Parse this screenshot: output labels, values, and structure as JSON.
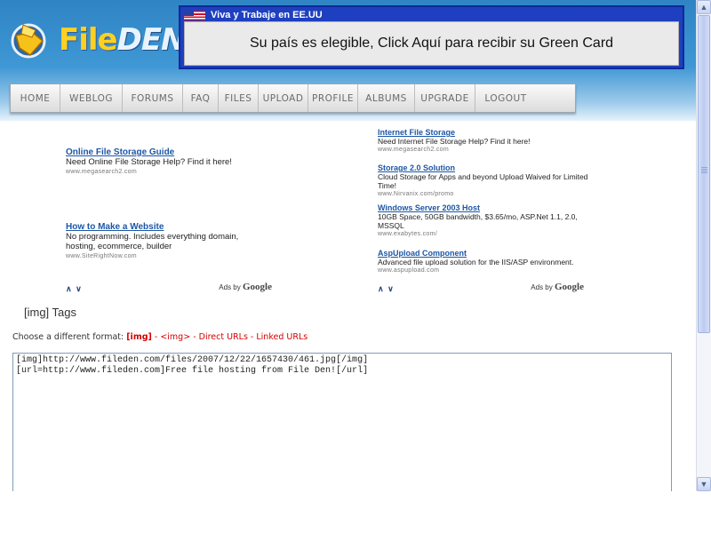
{
  "brand": {
    "file": "File",
    "den": "DEN"
  },
  "banner": {
    "heading": "Viva y Trabaje en EE.UU",
    "text": "Su país es elegible, Click Aquí para recibir su Green Card",
    "flag_icon": "us-flag-icon"
  },
  "nav": [
    "HOME",
    "WEBLOG",
    "FORUMS",
    "FAQ",
    "FILES",
    "UPLOAD",
    "PROFILE",
    "ALBUMS",
    "UPGRADE",
    "LOGOUT"
  ],
  "ads_left": [
    {
      "title": "Online File Storage Guide",
      "desc": "Need Online File Storage Help? Find it here!",
      "url": "www.megasearch2.com"
    },
    {
      "title": "How to Make a Website",
      "desc": "No programming. Includes everything domain, hosting, ecommerce, builder",
      "url": "www.SiteRightNow.com"
    }
  ],
  "ads_right": [
    {
      "title": "Internet File Storage",
      "desc": "Need Internet File Storage Help? Find it here!",
      "url": "www.megasearch2.com"
    },
    {
      "title": "Storage 2.0 Solution",
      "desc": "Cloud Storage for Apps and beyond Upload Waived for Limited Time!",
      "url": "www.Nirvanix.com/promo"
    },
    {
      "title": "Windows Server 2003 Host",
      "desc": "10GB Space, 50GB bandwidth, $3.65/mo, ASP.Net 1.1, 2.0, MSSQL",
      "url": "www.exabytes.com/"
    },
    {
      "title": "AspUpload Component",
      "desc": "Advanced file upload solution for the IIS/ASP environment.",
      "url": "www.aspupload.com"
    }
  ],
  "ads_footer": {
    "arrows": "∧ ∨",
    "adsby": "Ads by",
    "google": "Google"
  },
  "section_title": "[img] Tags",
  "format": {
    "prefix": "Choose a different format: ",
    "current": "[img]",
    "sep": " - ",
    "options": [
      "<img>",
      "Direct URLs",
      "Linked URLs"
    ]
  },
  "code": "[img]http://www.fileden.com/files/2007/12/22/1657430/461.jpg[/img]\n[url=http://www.fileden.com]Free file hosting from File Den![/url]",
  "colors": {
    "header_blue": "#3f97d4",
    "banner_blue": "#1e3fbf",
    "link_blue": "#1c57a6",
    "format_red": "#d50000"
  }
}
